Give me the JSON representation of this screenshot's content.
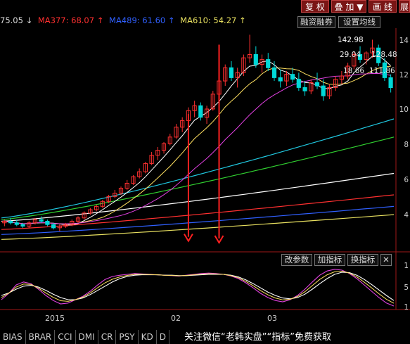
{
  "top_buttons": [
    "复 权",
    "叠 加 ▼",
    "画 线",
    "展"
  ],
  "legend": {
    "lead": "75.05 ↓",
    "items": [
      {
        "text": "MA377: 68.07 ↑",
        "color": "#ff3030"
      },
      {
        "text": "MA489: 61.60 ↑",
        "color": "#3060ff"
      },
      {
        "text": "MA610: 54.27 ↑",
        "color": "#e8e060"
      }
    ]
  },
  "buttons": {
    "margin_trading": "融资融券",
    "ma_settings": "设置均线",
    "change_params": "改参数",
    "add_indicator": "加指标",
    "switch_indicator": "换指标",
    "close": "✕"
  },
  "price_labels": {
    "high": "142.98",
    "mid": "29.04",
    "mid2": "128.48",
    "low": "18.66",
    "low2": "111.86"
  },
  "y_axis_ticks": [
    "14",
    "12",
    "10",
    "8",
    "6",
    "4"
  ],
  "osc_axis_ticks": [
    "1",
    "5",
    "1"
  ],
  "date_labels": [
    "2015",
    "02",
    "03"
  ],
  "indicator_tabs": [
    "BIAS",
    "BRAR",
    "CCI",
    "DMI",
    "CR",
    "PSY",
    "KD",
    "D"
  ],
  "watermark": "关注微信“老韩实盘”“指标”免费获取",
  "chart_data": {
    "type": "candlestick",
    "colors": {
      "up": "#ff3030",
      "down": "#00d8d8",
      "arrow": "#ff2020"
    },
    "ylim": [
      2,
      15
    ],
    "candles": [
      [
        3.2,
        3.4,
        3.0,
        3.3
      ],
      [
        3.3,
        3.5,
        3.1,
        3.2
      ],
      [
        3.2,
        3.4,
        3.0,
        3.1
      ],
      [
        3.1,
        3.2,
        2.9,
        3.0
      ],
      [
        3.0,
        3.3,
        2.9,
        3.2
      ],
      [
        3.2,
        3.5,
        3.1,
        3.4
      ],
      [
        3.4,
        3.6,
        3.2,
        3.3
      ],
      [
        3.3,
        3.4,
        3.0,
        3.1
      ],
      [
        3.1,
        3.2,
        2.8,
        2.9
      ],
      [
        2.9,
        3.1,
        2.7,
        3.0
      ],
      [
        3.0,
        3.2,
        2.9,
        3.1
      ],
      [
        3.1,
        3.4,
        3.0,
        3.3
      ],
      [
        3.3,
        3.6,
        3.2,
        3.5
      ],
      [
        3.5,
        3.9,
        3.4,
        3.8
      ],
      [
        3.8,
        4.1,
        3.7,
        4.0
      ],
      [
        4.0,
        4.3,
        3.9,
        4.2
      ],
      [
        4.2,
        4.6,
        4.1,
        4.5
      ],
      [
        4.5,
        4.9,
        4.4,
        4.8
      ],
      [
        4.8,
        5.2,
        4.7,
        5.0
      ],
      [
        5.0,
        5.4,
        4.9,
        5.3
      ],
      [
        5.3,
        5.8,
        5.2,
        5.6
      ],
      [
        5.6,
        6.1,
        5.5,
        6.0
      ],
      [
        6.0,
        6.5,
        5.9,
        6.3
      ],
      [
        6.3,
        6.9,
        6.2,
        6.8
      ],
      [
        6.8,
        7.5,
        6.7,
        7.3
      ],
      [
        7.3,
        7.8,
        7.0,
        7.6
      ],
      [
        7.6,
        8.1,
        7.4,
        8.0
      ],
      [
        8.0,
        8.6,
        7.9,
        8.4
      ],
      [
        8.4,
        9.2,
        8.3,
        9.0
      ],
      [
        9.0,
        9.6,
        8.7,
        9.4
      ],
      [
        9.4,
        10.2,
        9.2,
        10.0
      ],
      [
        10.0,
        10.6,
        9.6,
        10.3
      ],
      [
        10.3,
        10.5,
        9.4,
        9.6
      ],
      [
        9.6,
        10.3,
        9.2,
        10.1
      ],
      [
        10.1,
        11.2,
        10.0,
        11.0
      ],
      [
        11.0,
        12.0,
        10.8,
        11.8
      ],
      [
        11.8,
        12.8,
        11.5,
        12.6
      ],
      [
        12.6,
        13.0,
        11.8,
        12.0
      ],
      [
        12.0,
        12.6,
        11.4,
        12.3
      ],
      [
        12.3,
        13.4,
        12.1,
        13.2
      ],
      [
        13.2,
        14.6,
        12.9,
        13.4
      ],
      [
        13.4,
        13.9,
        12.6,
        12.8
      ],
      [
        12.8,
        13.4,
        12.3,
        13.1
      ],
      [
        13.1,
        13.5,
        12.4,
        12.6
      ],
      [
        12.6,
        13.0,
        11.8,
        12.0
      ],
      [
        12.0,
        12.5,
        11.4,
        11.8
      ],
      [
        11.8,
        12.4,
        11.5,
        12.2
      ],
      [
        12.2,
        12.6,
        11.7,
        11.9
      ],
      [
        11.9,
        12.3,
        11.2,
        11.4
      ],
      [
        11.4,
        11.8,
        10.9,
        11.2
      ],
      [
        11.2,
        11.9,
        11.0,
        11.7
      ],
      [
        11.7,
        12.3,
        11.3,
        11.5
      ],
      [
        11.5,
        11.9,
        10.6,
        10.9
      ],
      [
        10.9,
        11.6,
        10.7,
        11.4
      ],
      [
        11.4,
        12.1,
        11.2,
        11.9
      ],
      [
        11.9,
        12.4,
        11.6,
        12.1
      ],
      [
        12.1,
        12.9,
        11.9,
        12.7
      ],
      [
        12.7,
        13.6,
        12.5,
        13.4
      ],
      [
        13.4,
        13.9,
        12.9,
        13.1
      ],
      [
        13.1,
        13.6,
        12.8,
        13.5
      ],
      [
        13.5,
        14.3,
        13.2,
        13.8
      ],
      [
        13.8,
        14.0,
        12.7,
        12.9
      ],
      [
        12.9,
        13.2,
        11.8,
        12.0
      ],
      [
        12.0,
        12.2,
        11.1,
        11.4
      ]
    ],
    "ma_lines": [
      {
        "name": "MA377",
        "color": "#ff3030",
        "from": 2.8,
        "to": 4.9
      },
      {
        "name": "MA489",
        "color": "#3060ff",
        "from": 2.5,
        "to": 4.2
      },
      {
        "name": "MA610",
        "color": "#e8e060",
        "from": 2.2,
        "to": 3.7
      },
      {
        "name": "MA250",
        "color": "#ffffff",
        "from": 3.3,
        "to": 6.2
      },
      {
        "name": "MA120",
        "color": "#30d030",
        "from": 3.4,
        "to": 8.4
      },
      {
        "name": "MA60",
        "color": "#20c8e0",
        "from": 3.5,
        "to": 9.5
      }
    ],
    "arrows": [
      {
        "x_index": 30,
        "from": 9.8,
        "to": 2.1
      },
      {
        "x_index": 35,
        "from": 14.0,
        "to": 2.0
      }
    ],
    "oscillator": {
      "k": [
        20,
        35,
        55,
        62,
        58,
        45,
        30,
        18,
        10,
        12,
        20,
        28,
        40,
        55,
        68,
        75,
        78,
        80,
        82,
        81,
        80,
        79,
        78,
        77,
        76,
        78,
        80,
        82,
        83,
        82,
        80,
        76,
        70,
        60,
        48,
        35,
        25,
        18,
        15,
        20,
        30,
        45,
        62,
        78,
        88,
        92,
        90,
        82,
        70,
        55,
        40,
        25,
        12,
        5
      ],
      "d": [
        30,
        36,
        45,
        52,
        54,
        50,
        42,
        33,
        25,
        20,
        20,
        24,
        32,
        42,
        52,
        62,
        70,
        75,
        78,
        79,
        79,
        79,
        78,
        78,
        77,
        77,
        78,
        79,
        80,
        80,
        80,
        78,
        74,
        67,
        58,
        48,
        38,
        30,
        24,
        22,
        25,
        33,
        45,
        58,
        70,
        80,
        85,
        84,
        78,
        68,
        56,
        43,
        30,
        18
      ]
    }
  }
}
